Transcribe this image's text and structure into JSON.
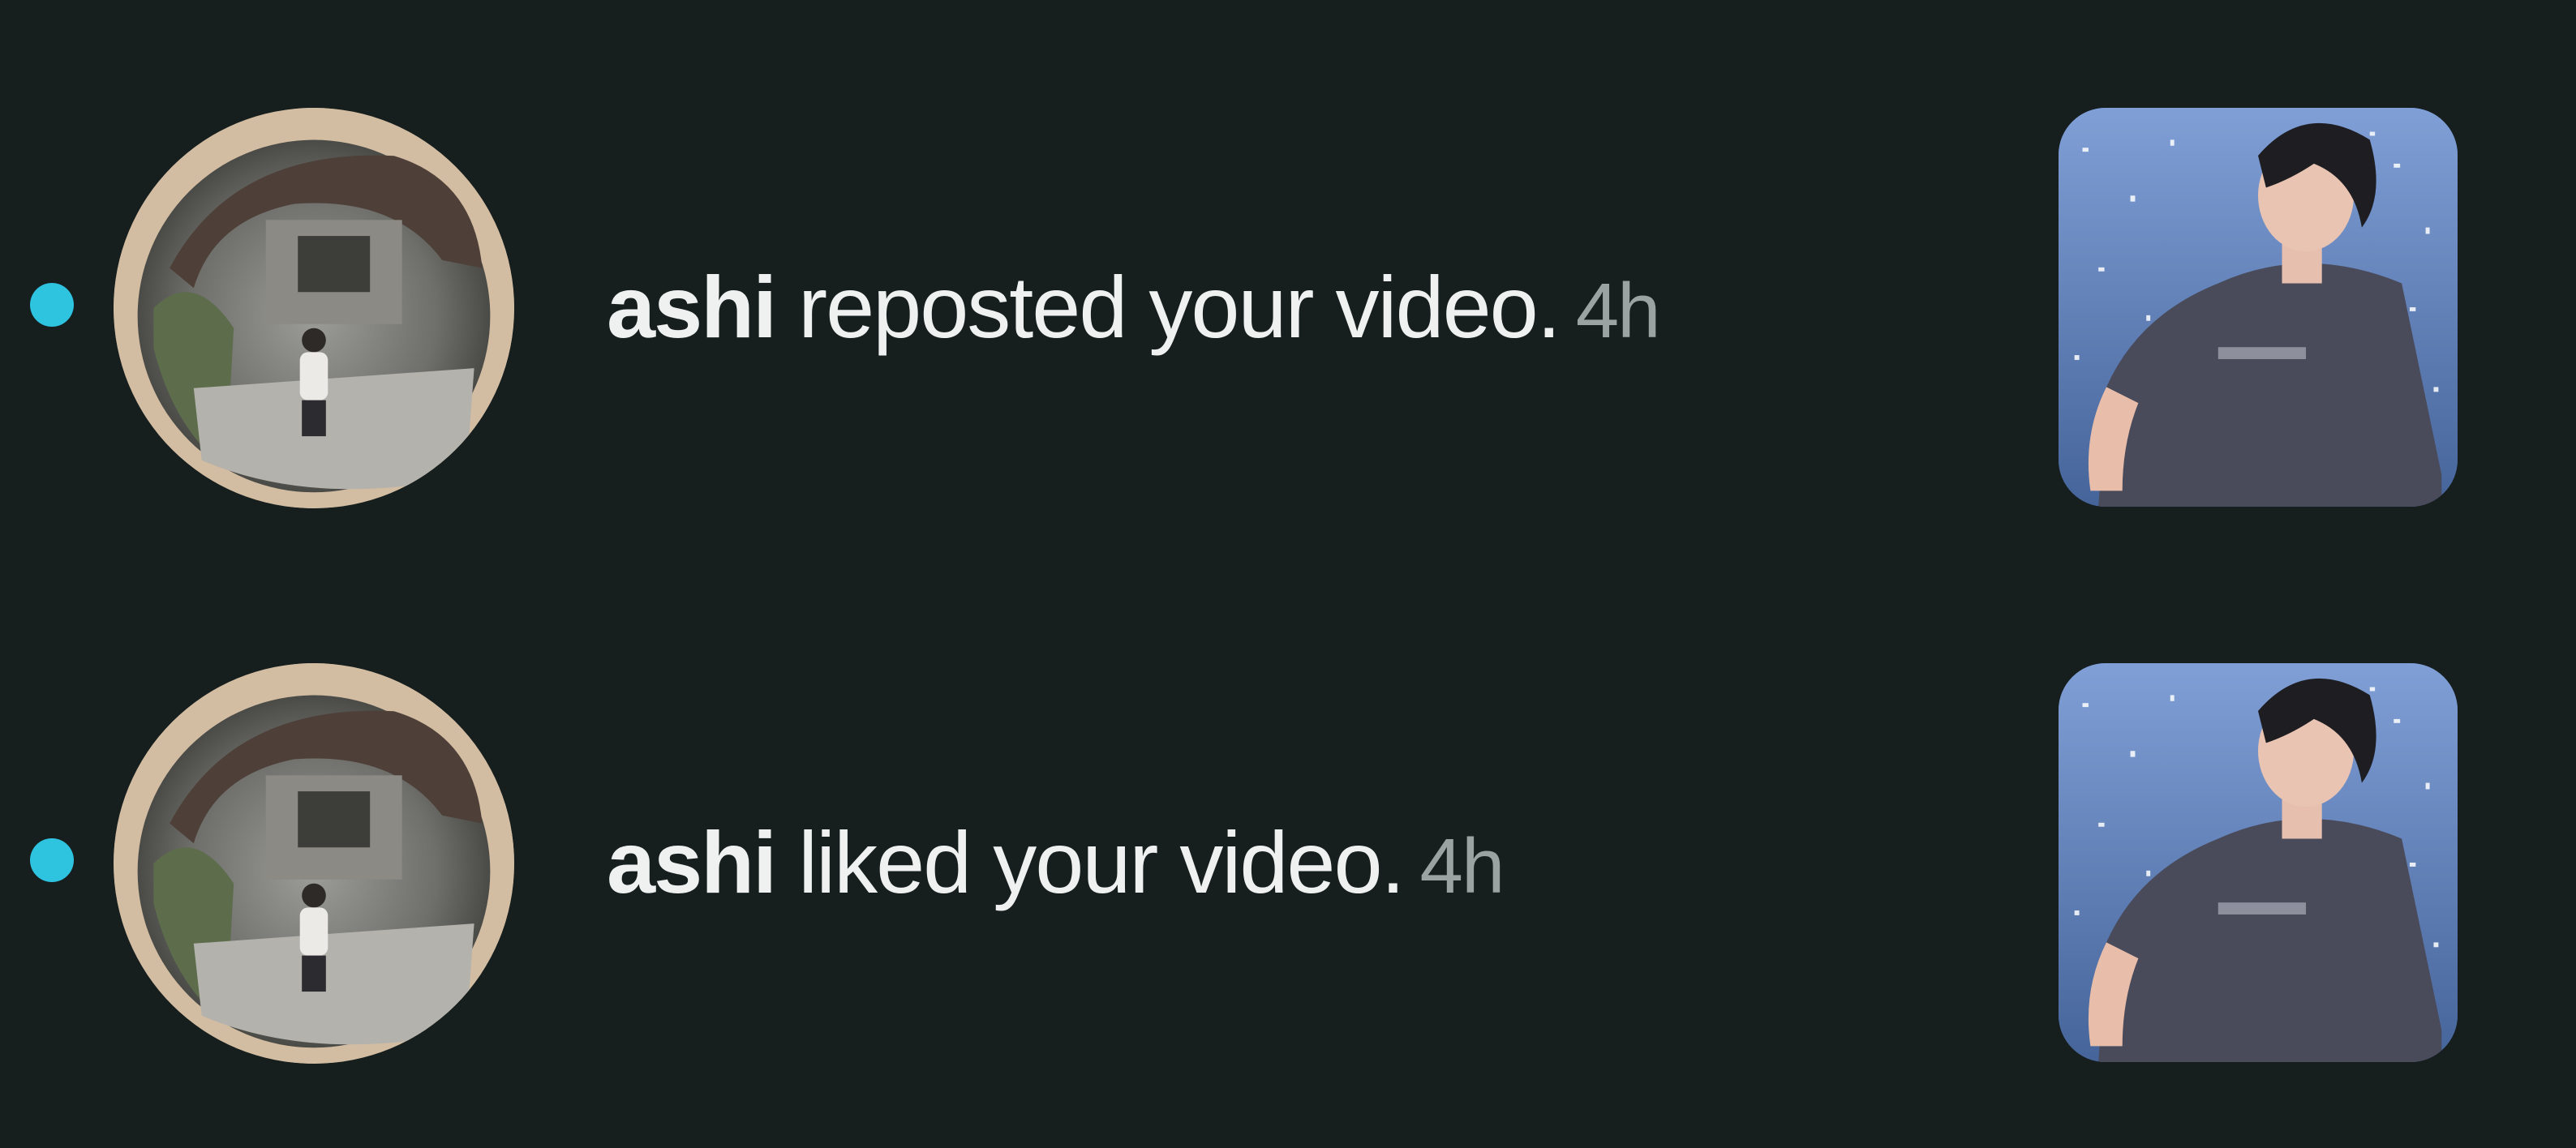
{
  "activity": {
    "items": [
      {
        "username": "ashi",
        "action": "reposted your video.",
        "time": "4h",
        "unread": true,
        "avatar_icon": "user-avatar-icon",
        "thumbnail_icon": "video-thumbnail"
      },
      {
        "username": "ashi",
        "action": "liked your video.",
        "time": "4h",
        "unread": true,
        "avatar_icon": "user-avatar-icon",
        "thumbnail_icon": "video-thumbnail"
      }
    ]
  },
  "colors": {
    "background": "#161e1e",
    "unread_dot": "#2ec4e0",
    "text_primary": "#eef1f0",
    "text_secondary": "#9aa3a2"
  }
}
